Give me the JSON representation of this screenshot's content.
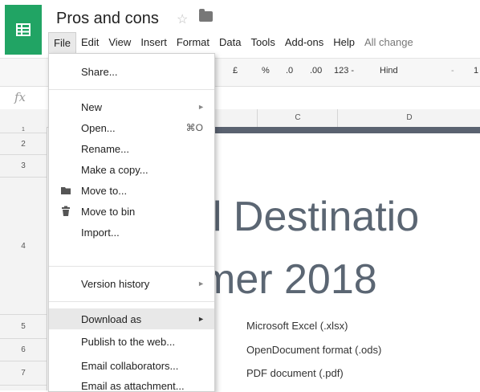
{
  "app": {
    "doc_title": "Pros and cons",
    "menus": [
      "File",
      "Edit",
      "View",
      "Insert",
      "Format",
      "Data",
      "Tools",
      "Add-ons",
      "Help"
    ],
    "save_status": "All change"
  },
  "toolbar": {
    "currency": "£",
    "percent": "%",
    "dec_less": ".0",
    "dec_more": ".00",
    "format_more": "123 -",
    "font": "Hind",
    "font_arrow": "-",
    "font_size": "1"
  },
  "formula_bar": {
    "fx": "fx"
  },
  "columns": {
    "c": "C",
    "d": "D"
  },
  "rows": [
    "1",
    "2",
    "3",
    "4",
    "5",
    "6",
    "7"
  ],
  "sheet": {
    "heading_line1": "el Destinatio",
    "heading_line2": "mer 2018",
    "submenu_items": [
      "Microsoft Excel (.xlsx)",
      "OpenDocument format (.ods)",
      "PDF document (.pdf)"
    ]
  },
  "file_menu": {
    "share": "Share...",
    "new": "New",
    "open": "Open...",
    "open_shortcut": "⌘O",
    "rename": "Rename...",
    "make_copy": "Make a copy...",
    "move_to": "Move to...",
    "move_to_bin": "Move to bin",
    "import": "Import...",
    "version_history": "Version history",
    "download_as": "Download as",
    "publish": "Publish to the web...",
    "email_collaborators": "Email collaborators...",
    "email_attachment": "Email as attachment..."
  }
}
